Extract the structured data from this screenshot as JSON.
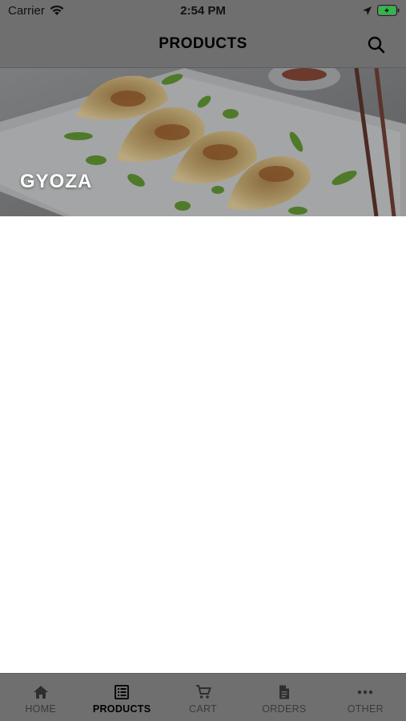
{
  "status_bar": {
    "carrier": "Carrier",
    "time": "2:54 PM",
    "battery_color": "#2fb84a"
  },
  "nav": {
    "title": "PRODUCTS",
    "search_icon": "search-icon"
  },
  "banner": {
    "label": "GYOZA"
  },
  "tabs": [
    {
      "label": "HOME",
      "icon": "home-icon",
      "active": false
    },
    {
      "label": "PRODUCTS",
      "icon": "list-icon",
      "active": true
    },
    {
      "label": "CART",
      "icon": "cart-icon",
      "active": false
    },
    {
      "label": "ORDERS",
      "icon": "document-icon",
      "active": false
    },
    {
      "label": "OTHER",
      "icon": "more-icon",
      "active": false
    }
  ],
  "colors": {
    "overlay_gray": "#6f6f6f",
    "inactive_tab": "#3a3a3a",
    "active_tab": "#000000"
  }
}
